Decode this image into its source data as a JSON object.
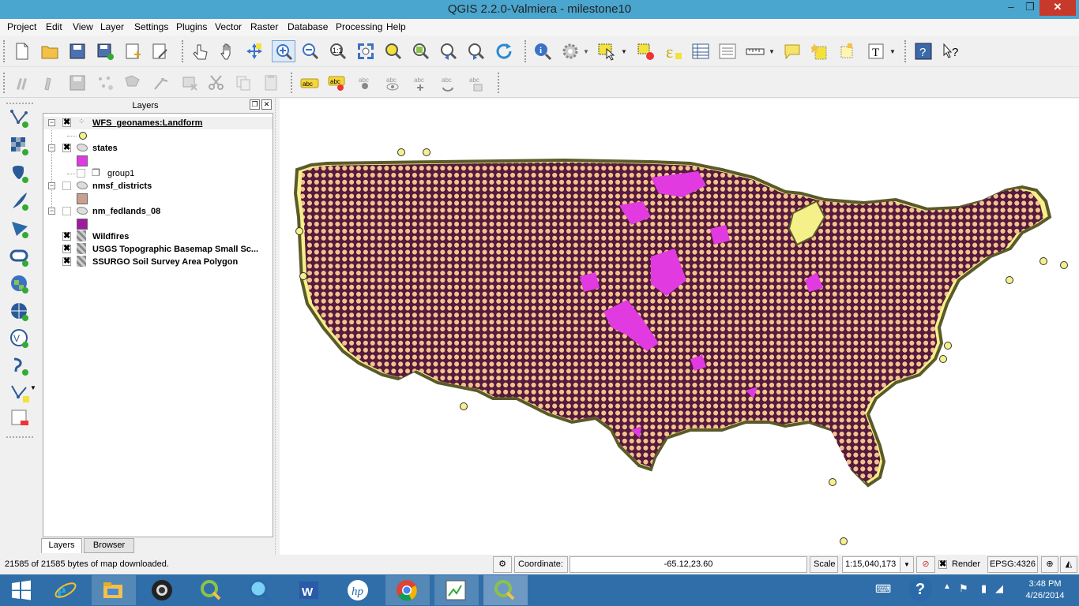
{
  "window": {
    "title": "QGIS 2.2.0-Valmiera - milestone10",
    "minimize": "–",
    "restore": "❐",
    "close": "✕"
  },
  "menu": [
    "Project",
    "Edit",
    "View",
    "Layer",
    "Settings",
    "Plugins",
    "Vector",
    "Raster",
    "Database",
    "Processing",
    "Help"
  ],
  "toolbar_icons": [
    "new-project-icon",
    "open-project-icon",
    "save-project-icon",
    "save-as-icon",
    "new-print-composer-icon",
    "composer-manager-icon",
    "touch-zoom-icon",
    "pan-icon",
    "pan-to-selection-icon",
    "zoom-in-icon",
    "zoom-out-icon",
    "zoom-actual-size-icon",
    "zoom-full-icon",
    "zoom-to-selection-icon",
    "zoom-to-layer-icon",
    "zoom-last-icon",
    "zoom-next-icon",
    "refresh-icon",
    "identify-icon",
    "run-action-icon",
    "select-features-icon",
    "deselect-icon",
    "field-calculator-icon",
    "attribute-table-icon",
    "statistics-icon",
    "measure-icon",
    "map-tips-icon",
    "new-bookmark-icon",
    "show-bookmarks-icon",
    "text-annotation-icon",
    "help-contents-icon",
    "whats-this-icon"
  ],
  "edit_toolbar_icons": [
    "current-edits-icon",
    "toggle-editing-icon",
    "save-layer-edits-icon",
    "add-feature-icon",
    "move-feature-icon",
    "node-tool-icon",
    "delete-selected-icon",
    "cut-features-icon",
    "copy-features-icon",
    "paste-features-icon"
  ],
  "label_toolbar_icons": [
    "labeling-icon",
    "highlight-pinned-labels-icon",
    "pin-labels-icon",
    "show-hide-labels-icon",
    "move-label-icon",
    "rotate-label-icon",
    "change-label-icon"
  ],
  "left_toolbar_icons": [
    "add-vector-layer-icon",
    "add-raster-layer-icon",
    "add-postgis-layer-icon",
    "add-spatialite-layer-icon",
    "add-mssql-layer-icon",
    "add-oracle-layer-icon",
    "add-wms-layer-icon",
    "add-wcs-layer-icon",
    "add-wfs-layer-icon",
    "add-delimited-text-icon",
    "new-shapefile-icon",
    "remove-layer-icon"
  ],
  "layers_panel": {
    "title": "Layers",
    "float_btn": "❐",
    "close_btn": "✕",
    "layers": [
      {
        "name": "WFS_geonames:Landform",
        "checked": "✖",
        "expander": "−",
        "swatch": "#f5f08a"
      },
      {
        "name": "states",
        "checked": "✖",
        "expander": "−",
        "swatch": "#e63de6"
      },
      {
        "name": "nmsf_districts",
        "checked": "",
        "expander": "−",
        "swatch": "#c9a08e"
      },
      {
        "name": "nm_fedlands_08",
        "checked": "",
        "expander": "−",
        "swatch": "#a01aa0"
      },
      {
        "name": "Wildfires",
        "checked": "✖"
      },
      {
        "name": "USGS Topographic Basemap Small Sc...",
        "checked": "✖"
      },
      {
        "name": "SSURGO Soil Survey Area Polygon",
        "checked": "✖"
      }
    ],
    "group": {
      "name": "group1",
      "checked": ""
    },
    "tabs": [
      "Layers",
      "Browser"
    ]
  },
  "colors": {
    "map_fill": "#e03ae0",
    "point_fill": "#f4c08e",
    "point_edge": "#4a0a3a",
    "coastal_point": "#f5f08a"
  },
  "status": {
    "message": "21585 of 21585 bytes of map downloaded.",
    "coordinate_label": "Coordinate:",
    "coordinate_value": "-65.12,23.60",
    "scale_label": "Scale",
    "scale_value": "1:15,040,173",
    "render_label": "Render",
    "crs": "EPSG:4326",
    "render_checked": "✖"
  },
  "taskbar": {
    "time": "3:48 PM",
    "date": "4/26/2014",
    "apps": [
      "start-icon",
      "internet-explorer-icon",
      "file-explorer-icon",
      "camera-icon",
      "qgis-icon",
      "search-app-icon",
      "word-icon",
      "hp-icon",
      "chrome-icon",
      "qgis-desktop-icon",
      "qgis-active-icon"
    ]
  }
}
